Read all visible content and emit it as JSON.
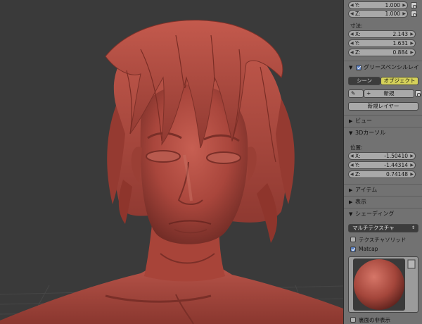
{
  "panel": {
    "scale": {
      "y": {
        "label": "Y:",
        "value": "1.000"
      },
      "z": {
        "label": "Z:",
        "value": "1.000"
      }
    },
    "dimensions": {
      "label": "寸法:",
      "x": {
        "label": "X:",
        "value": "2.143"
      },
      "y": {
        "label": "Y:",
        "value": "1.631"
      },
      "z": {
        "label": "Z:",
        "value": "0.884"
      }
    },
    "grease_pencil": {
      "title": "グリースペンシルレイ",
      "scene_tab": "シーン",
      "object_tab": "オブジェクト",
      "new_label": "新規",
      "new_layer_label": "新規レイヤー"
    },
    "view": {
      "title": "ビュー"
    },
    "cursor3d": {
      "title": "3Dカーソル",
      "location_label": "位置:",
      "x": {
        "label": "X:",
        "value": "-1.50410"
      },
      "y": {
        "label": "Y:",
        "value": "-1.44314"
      },
      "z": {
        "label": "Z:",
        "value": "0.74148"
      }
    },
    "item": {
      "title": "アイテム"
    },
    "display": {
      "title": "表示"
    },
    "shading": {
      "title": "シェーディング",
      "mode": "マルチテクスチャ",
      "textured_solid": "テクスチャソリッド",
      "matcap": "Matcap",
      "backface_culling": "裏面の非表示"
    }
  },
  "colors": {
    "viewport_bg": "#3a3a3a",
    "panel_bg": "#727272",
    "field_bg": "#a9a9a9",
    "active_tab": "#d6d25a",
    "skin": "#a8453b"
  },
  "icons": [
    "lock-icon",
    "checkbox-icon",
    "triangle-right-icon",
    "triangle-down-icon",
    "pencil-icon",
    "plus-icon",
    "matcap-sphere-icon"
  ]
}
